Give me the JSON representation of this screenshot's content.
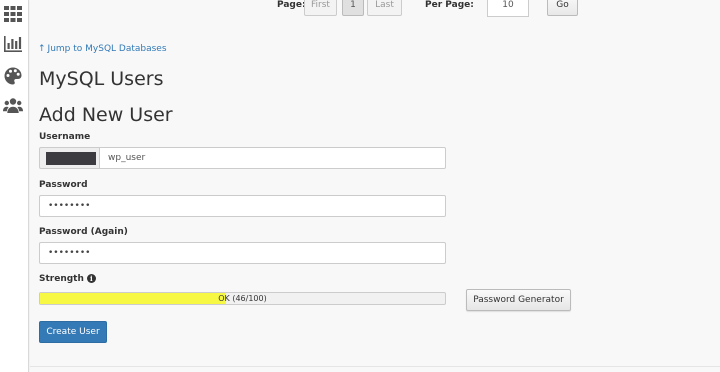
{
  "sidebar": {
    "icons": [
      "grid-icon",
      "chart-icon",
      "palette-icon",
      "users-icon"
    ]
  },
  "pagination": {
    "page_label": "Page:",
    "first_label": "First",
    "current_page": "1",
    "last_label": "Last",
    "per_page_label": "Per Page:",
    "per_page_value": "10",
    "go_label": "Go"
  },
  "jump_link": "Jump to MySQL Databases",
  "title": "MySQL Users",
  "subtitle": "Add New User",
  "form": {
    "username_label": "Username",
    "username_value": "wp_user",
    "password_label": "Password",
    "password_value": "••••••••",
    "password_again_label": "Password (Again)",
    "password_again_value": "••••••••",
    "strength_label": "Strength",
    "strength_text": "OK (46/100)",
    "strength_value": 46,
    "password_generator_label": "Password Generator",
    "create_user_label": "Create User"
  },
  "colors": {
    "accent": "#337ab7",
    "strength_fill": "#f6f843"
  }
}
